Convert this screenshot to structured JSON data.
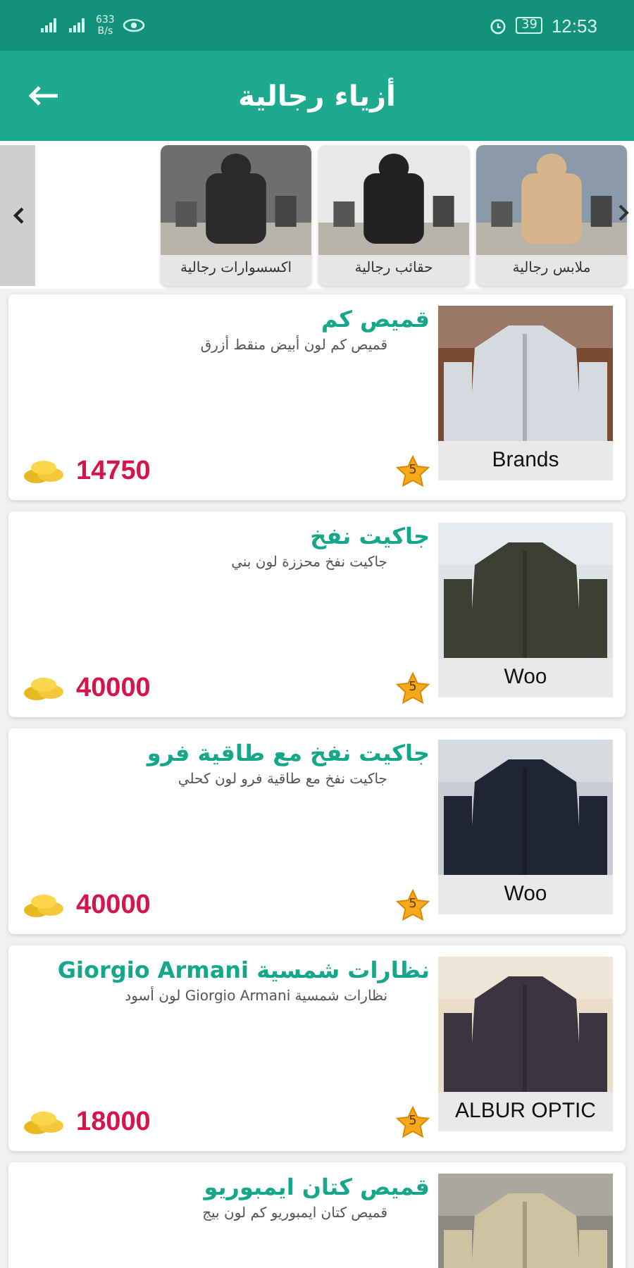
{
  "status_bar": {
    "speed": "633",
    "speed_unit": "B/s",
    "battery": "39",
    "time": "12:53"
  },
  "app_bar": {
    "title": "أزياء رجالية"
  },
  "categories": [
    {
      "label": "ملابس رجالية"
    },
    {
      "label": "حقائب رجالية"
    },
    {
      "label": "اكسسوارات رجالية"
    }
  ],
  "products": [
    {
      "title": "قميص كم",
      "description": "قميص كم لون أبيض منقط أزرق",
      "price": "14750",
      "rating": "5",
      "brand": "Brands"
    },
    {
      "title": "جاكيت نفخ",
      "description": "جاكيت نفخ محززة لون بني",
      "price": "40000",
      "rating": "5",
      "brand": "Woo"
    },
    {
      "title": "جاكيت نفخ مع طاقية فرو",
      "description": "جاكيت نفخ مع طاقية فرو لون كحلي",
      "price": "40000",
      "rating": "5",
      "brand": "Woo"
    },
    {
      "title": "نظارات شمسية Giorgio Armani",
      "description": "نظارات شمسية Giorgio Armani لون أسود",
      "price": "18000",
      "rating": "5",
      "brand": "ALBUR OPTIC"
    },
    {
      "title": "قميص كتان ايمبوريو",
      "description": "قميص كتان ايمبوريو كم لون بيج"
    }
  ]
}
